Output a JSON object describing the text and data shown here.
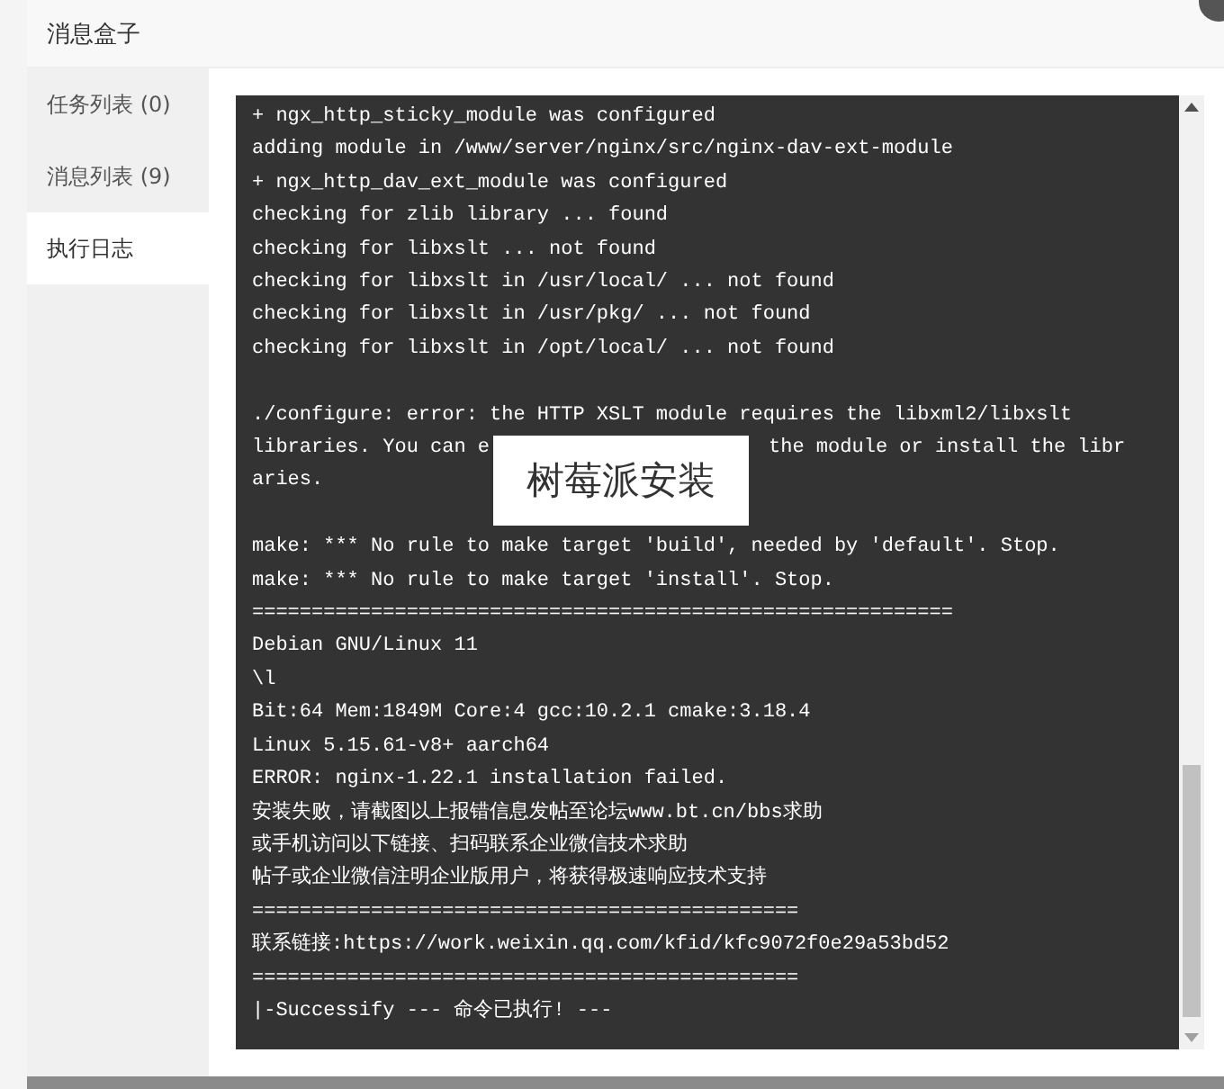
{
  "dialog": {
    "title": "消息盒子"
  },
  "tabs": [
    {
      "label": "任务列表 (0)",
      "selected": false
    },
    {
      "label": "消息列表 (9)",
      "selected": false
    },
    {
      "label": "执行日志",
      "selected": true
    }
  ],
  "log": {
    "lines": [
      [
        "+ ngx_http_sticky_module was configured"
      ],
      [
        "adding module in /www/server/nginx/src/nginx-dav-ext-module"
      ],
      [
        "+ ngx_http_dav_ext_module was configured"
      ],
      [
        "checking for zlib library ... found"
      ],
      [
        "checking for libxslt ... not found"
      ],
      [
        "checking for libxslt in /usr/local/ ... not found"
      ],
      [
        "checking for libxslt in /usr/pkg/ ... not found"
      ],
      [
        "checking for libxslt in /opt/local/ ... not found"
      ],
      {
        "blank_before": true,
        "text": [
          "./configure: error: the HTTP XSLT module requires the libxml2/libxslt"
        ]
      },
      [
        "libraries. You can e",
        "the module or install the libr"
      ],
      [
        "aries."
      ],
      {
        "blank_before": true,
        "text": [
          "make: *** No rule to make target 'build', needed by 'default'. Stop."
        ]
      },
      [
        "make: *** No rule to make target 'install'. Stop."
      ],
      [
        "==========================================================="
      ],
      [
        "Debian GNU/Linux 11"
      ],
      [
        "\\l"
      ],
      [
        "Bit:64 Mem:1849M Core:4 gcc:10.2.1 cmake:3.18.4"
      ],
      [
        "Linux 5.15.61-v8+ aarch64"
      ],
      [
        "ERROR: nginx-1.22.1 installation failed."
      ],
      [
        "安装失败，请截图以上报错信息发帖至论坛www.bt.cn/bbs求助"
      ],
      [
        "或手机访问以下链接、扫码联系企业微信技术求助"
      ],
      [
        "帖子或企业微信注明企业版用户，将获得极速响应技术支持"
      ],
      [
        "=============================================="
      ],
      [
        "联系链接:https://work.weixin.qq.com/kfid/kfc9072f0e29a53bd52"
      ],
      [
        "=============================================="
      ],
      [
        "|-Successify --- 命令已执行! ---"
      ]
    ]
  },
  "caption": "树莓派安装"
}
